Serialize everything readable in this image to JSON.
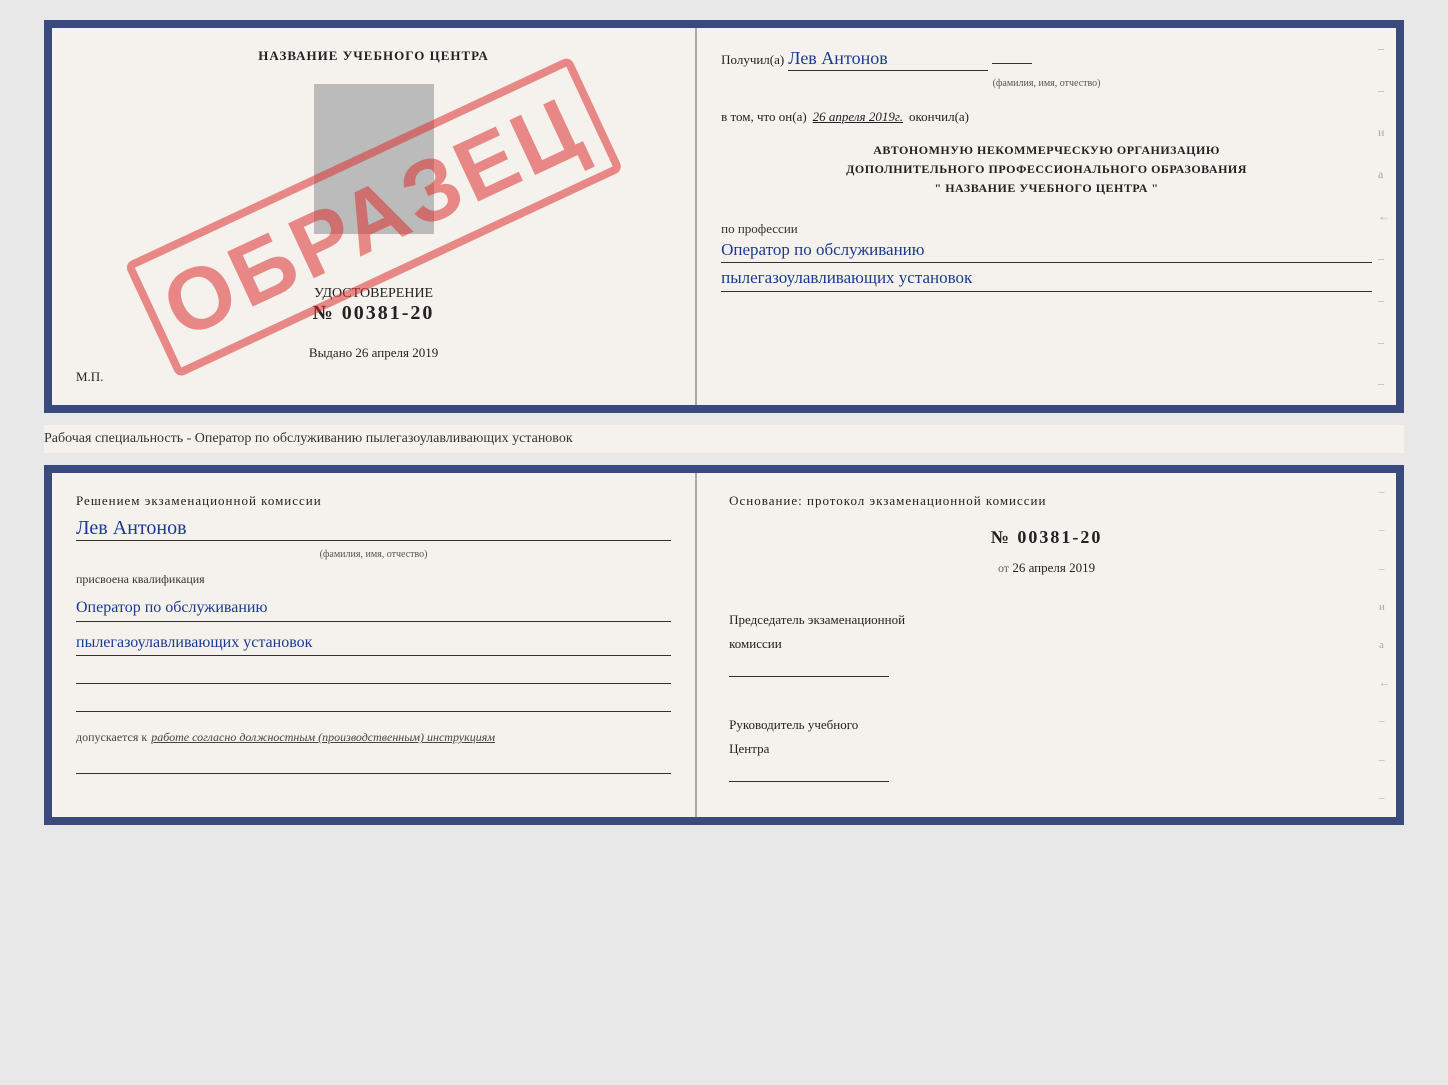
{
  "page": {
    "background": "#e8e8e8"
  },
  "top_cert": {
    "left": {
      "title": "НАЗВАНИЕ УЧЕБНОГО ЦЕНТРА",
      "watermark": "ОБРАЗЕЦ",
      "doc_label": "УДОСТОВЕРЕНИЕ",
      "doc_number": "№ 00381-20",
      "issued_label": "Выдано",
      "issued_date": "26 апреля 2019",
      "mp_label": "М.П."
    },
    "right": {
      "received_label": "Получил(а)",
      "received_name": "Лев Антонов",
      "fio_subtitle": "(фамилия, имя, отчество)",
      "completed_prefix": "в том, что он(а)",
      "completed_date": "26 апреля 2019г.",
      "completed_suffix": "окончил(а)",
      "org_line1": "АВТОНОМНУЮ НЕКОММЕРЧЕСКУЮ ОРГАНИЗАЦИЮ",
      "org_line2": "ДОПОЛНИТЕЛЬНОГО ПРОФЕССИОНАЛЬНОГО ОБРАЗОВАНИЯ",
      "org_line3": "\"   НАЗВАНИЕ УЧЕБНОГО ЦЕНТРА   \"",
      "profession_label": "по профессии",
      "profession_line1": "Оператор по обслуживанию",
      "profession_line2": "пылегазоулавливающих установок"
    }
  },
  "middle": {
    "text": "Рабочая специальность - Оператор по обслуживанию пылегазоулавливающих установок"
  },
  "bottom_cert": {
    "left": {
      "decision_label": "Решением экзаменационной комиссии",
      "person_name": "Лев Антонов",
      "fio_subtitle": "(фамилия, имя, отчество)",
      "qualification_label": "присвоена квалификация",
      "qualification_line1": "Оператор по обслуживанию",
      "qualification_line2": "пылегазоулавливающих установок",
      "permission_prefix": "допускается к",
      "permission_text": "работе согласно должностным (производственным) инструкциям"
    },
    "right": {
      "basis_label": "Основание: протокол экзаменационной комиссии",
      "protocol_number": "№  00381-20",
      "protocol_date_prefix": "от",
      "protocol_date": "26 апреля 2019",
      "chairman_label": "Председатель экзаменационной",
      "chairman_label2": "комиссии",
      "head_label": "Руководитель учебного",
      "head_label2": "Центра"
    }
  }
}
